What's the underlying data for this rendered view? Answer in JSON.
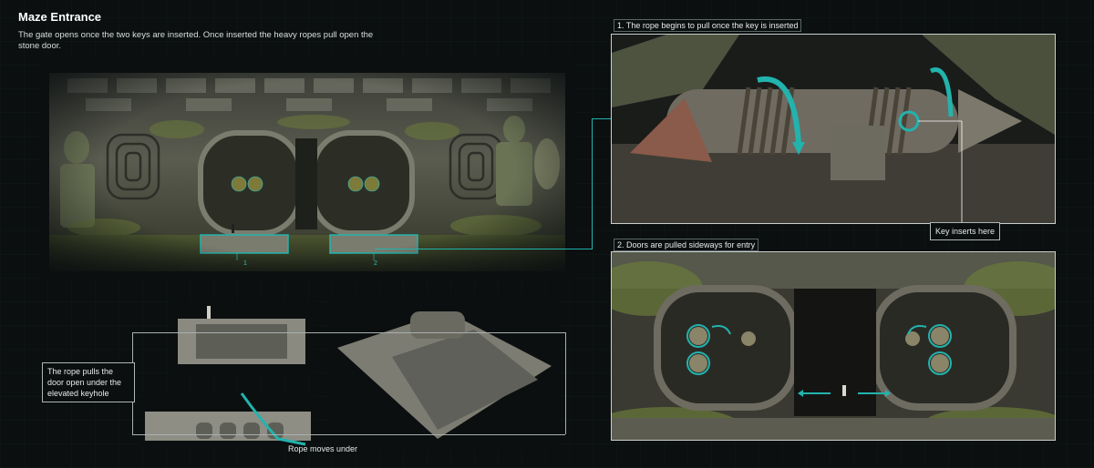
{
  "header": {
    "title": "Maze Entrance",
    "description": "The gate opens once the two keys are inserted. Once inserted the heavy ropes pull open the stone door."
  },
  "main_scene": {
    "markers": [
      "1",
      "2"
    ]
  },
  "panel_rope": {
    "label": "1. The rope begins to pull once the key is inserted",
    "callout": "Key inserts here"
  },
  "panel_doors": {
    "label": "2. Doors are pulled sideways for entry"
  },
  "bottom_left": {
    "callout": "The rope pulls the door open under the elevated keyhole",
    "arrow_label": "Rope moves under"
  },
  "colors": {
    "accent": "#22b3ad",
    "background": "#0b0f10",
    "stone": "#6f7266",
    "moss": "#6b7a3a"
  }
}
